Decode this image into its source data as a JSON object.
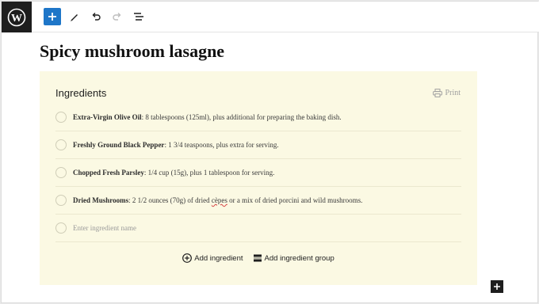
{
  "post": {
    "title": "Spicy mushroom lasagne"
  },
  "recipe_block": {
    "heading": "Ingredients",
    "print_label": "Print",
    "ingredients": [
      {
        "name": "Extra-Virgin Olive Oil",
        "sep": ":",
        "pre": " 8 tablespoons (125ml), plus additional for preparing the baking dish.",
        "flag": "",
        "post": ""
      },
      {
        "name": "Freshly Ground Black Pepper",
        "sep": ":",
        "pre": " 1 3/4 teaspoons, plus extra for serving.",
        "flag": "",
        "post": ""
      },
      {
        "name": "Chopped Fresh Parsley",
        "sep": ":",
        "pre": " 1/4 cup (15g), plus 1 tablespoon for serving.",
        "flag": "",
        "post": ""
      },
      {
        "name": "Dried Mushrooms",
        "sep": ":",
        "pre": " 2 1/2 ounces (70g) of dried ",
        "flag": "cèpes",
        "post": " or a mix of dried porcini and wild mushrooms."
      }
    ],
    "input_placeholder": "Enter ingredient name",
    "add_ingredient_label": "Add ingredient",
    "add_group_label": "Add ingredient group"
  },
  "colors": {
    "accent": "#1e76c8",
    "card_bg": "#fbf9e3",
    "dark": "#1e1e1e"
  },
  "icons": {
    "toolbar": [
      "wordpress-logo-icon",
      "plus-icon",
      "pen-icon",
      "undo-icon",
      "redo-icon",
      "list-view-icon"
    ],
    "card": [
      "printer-icon",
      "add-circle-icon",
      "group-icon"
    ],
    "floating": [
      "plus-icon"
    ]
  }
}
